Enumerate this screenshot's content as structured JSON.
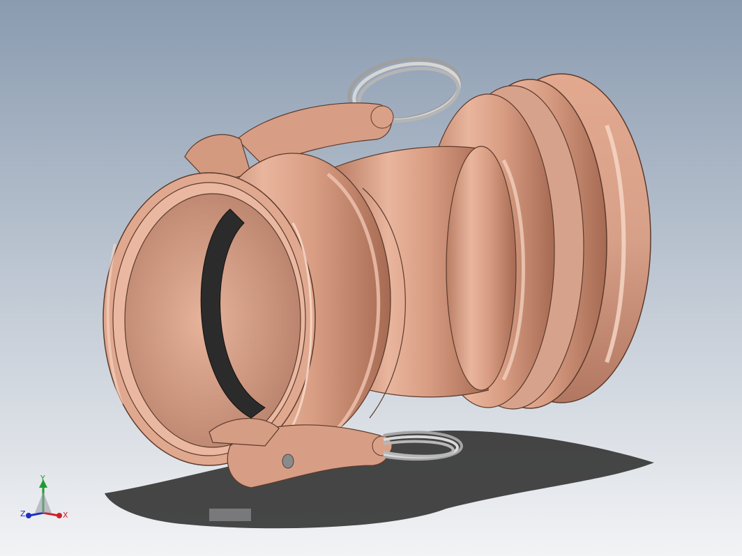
{
  "viewport": {
    "background_top": "#8a9bb0",
    "background_bottom": "#f2f3f5",
    "model_color": "#d99e84",
    "model_shadow": "#7d4f3c",
    "model_highlight": "#f7d8c8",
    "gasket_color": "#2b2b2b",
    "ring_color": "#c9c9c9",
    "shadow_color": "#333333"
  },
  "triad": {
    "x_label": "X",
    "y_label": "Y",
    "z_label": "Z",
    "x_color": "#d0202a",
    "y_color": "#1f9a2f",
    "z_color": "#1f2fbf"
  }
}
